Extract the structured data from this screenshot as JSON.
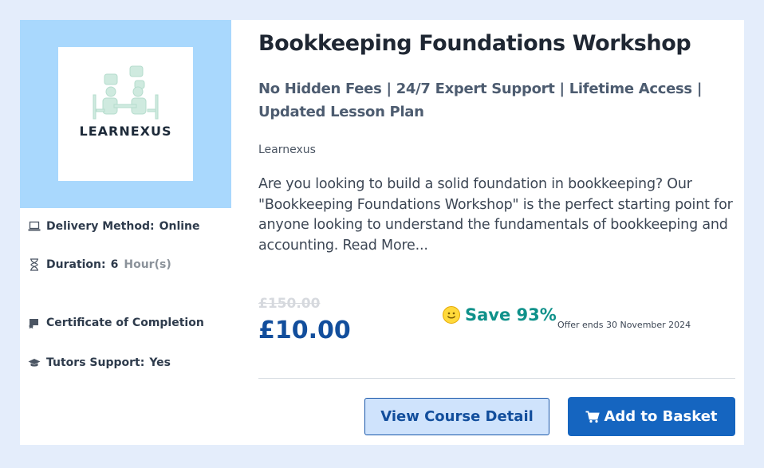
{
  "course": {
    "title": "Bookkeeping Foundations Workshop",
    "subtitle": "No Hidden Fees | 24/7 Expert Support | Lifetime Access | Updated Lesson Plan",
    "provider": "Learnexus",
    "description": "Are you looking to build a solid foundation in bookkeeping? Our \"Bookkeeping Foundations Workshop\" is the perfect starting point for anyone looking to understand the fundamentals of bookkeeping and accounting. Read More...",
    "logo_text": "LEARNEXUS"
  },
  "meta": {
    "delivery_label": "Delivery Method:",
    "delivery_value": "Online",
    "duration_label": "Duration:",
    "duration_value": "6",
    "duration_unit": "Hour(s)",
    "certificate_label": "Certificate of Completion",
    "tutors_label": "Tutors Support:",
    "tutors_value": "Yes"
  },
  "pricing": {
    "old_price": "£150.00",
    "price": "£10.00",
    "save_label": "Save 93%",
    "offer_text": "Offer ends 30 November 2024"
  },
  "actions": {
    "view_detail_label": "View Course Detail",
    "add_basket_label": "Add to Basket"
  },
  "icons": {
    "delivery": "laptop-icon",
    "duration": "hourglass-icon",
    "certificate": "certificate-icon",
    "tutors": "graduation-cap-icon",
    "save": "smile-icon",
    "cart": "cart-icon"
  },
  "colors": {
    "background": "#e4edfb",
    "thumb_bg": "#a9d8fd",
    "primary": "#1565c0",
    "price": "#124e9c",
    "save": "#0f918a"
  }
}
